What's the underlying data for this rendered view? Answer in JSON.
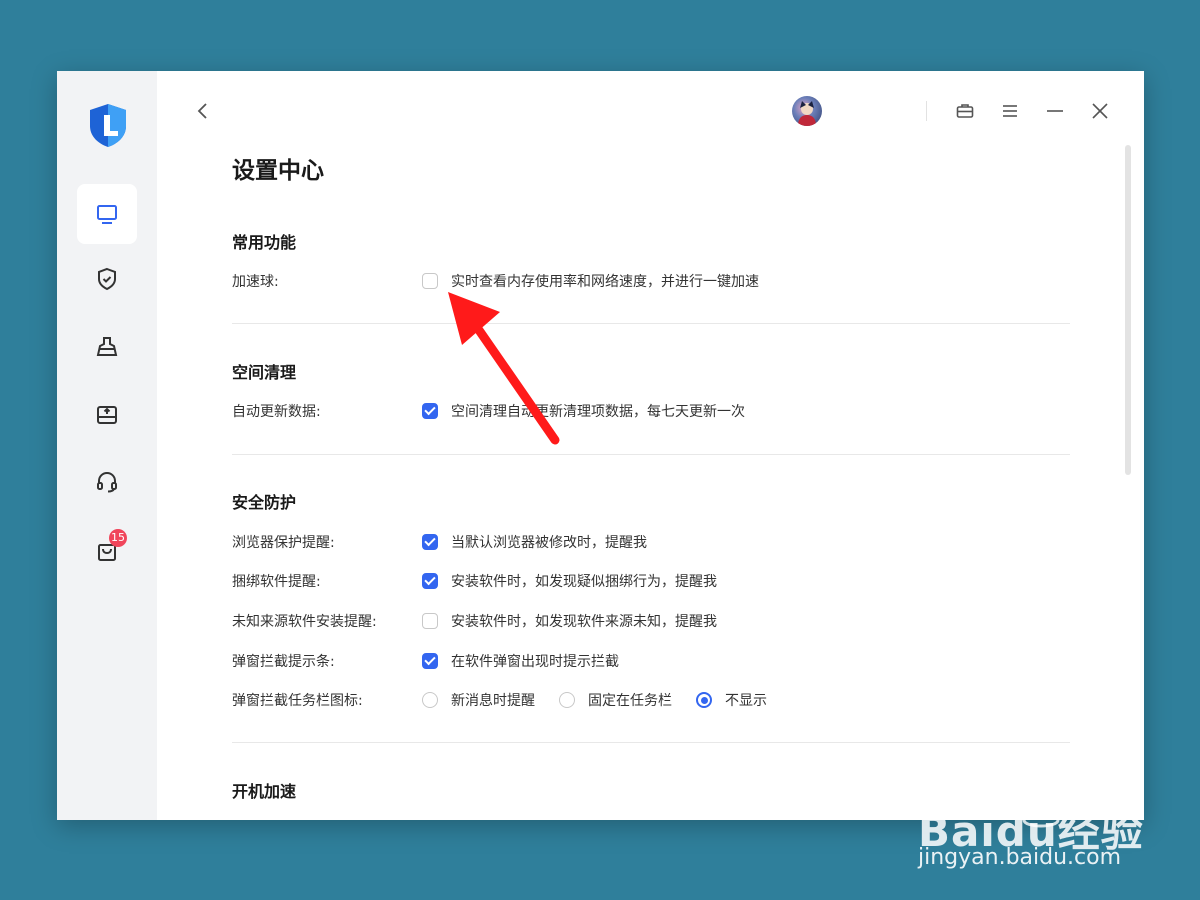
{
  "header": {
    "page_title": "设置中心"
  },
  "sidebar": {
    "items": [
      {
        "icon": "monitor-icon",
        "active": true
      },
      {
        "icon": "shield-icon"
      },
      {
        "icon": "broom-icon"
      },
      {
        "icon": "box-upload-icon"
      },
      {
        "icon": "headset-icon"
      },
      {
        "icon": "bag-icon",
        "badge": "15"
      }
    ]
  },
  "sections": {
    "common": {
      "title": "常用功能",
      "rows": [
        {
          "label": "加速球:",
          "options": [
            {
              "type": "checkbox",
              "checked": false,
              "text": "实时查看内存使用率和网络速度，并进行一键加速"
            }
          ]
        }
      ]
    },
    "cleanup": {
      "title": "空间清理",
      "rows": [
        {
          "label": "自动更新数据:",
          "options": [
            {
              "type": "checkbox",
              "checked": true,
              "text": "空间清理自动更新清理项数据，每七天更新一次"
            }
          ]
        }
      ]
    },
    "security": {
      "title": "安全防护",
      "rows": [
        {
          "label": "浏览器保护提醒:",
          "options": [
            {
              "type": "checkbox",
              "checked": true,
              "text": "当默认浏览器被修改时，提醒我"
            }
          ]
        },
        {
          "label": "捆绑软件提醒:",
          "options": [
            {
              "type": "checkbox",
              "checked": true,
              "text": "安装软件时，如发现疑似捆绑行为，提醒我"
            }
          ]
        },
        {
          "label": "未知来源软件安装提醒:",
          "options": [
            {
              "type": "checkbox",
              "checked": false,
              "text": "安装软件时，如发现软件来源未知，提醒我"
            }
          ]
        },
        {
          "label": "弹窗拦截提示条:",
          "options": [
            {
              "type": "checkbox",
              "checked": true,
              "text": "在软件弹窗出现时提示拦截"
            }
          ]
        },
        {
          "label": "弹窗拦截任务栏图标:",
          "options": [
            {
              "type": "radio",
              "checked": false,
              "text": "新消息时提醒"
            },
            {
              "type": "radio",
              "checked": false,
              "text": "固定在任务栏"
            },
            {
              "type": "radio",
              "checked": true,
              "text": "不显示"
            }
          ]
        }
      ]
    },
    "boot": {
      "title": "开机加速"
    }
  },
  "watermark": {
    "brand": "Baidu经验",
    "url": "jingyan.baidu.com"
  },
  "colors": {
    "accent": "#3366f0",
    "background": "#2f7f9b",
    "badge": "#f0455b",
    "annotation_arrow": "#ff1a1a"
  }
}
